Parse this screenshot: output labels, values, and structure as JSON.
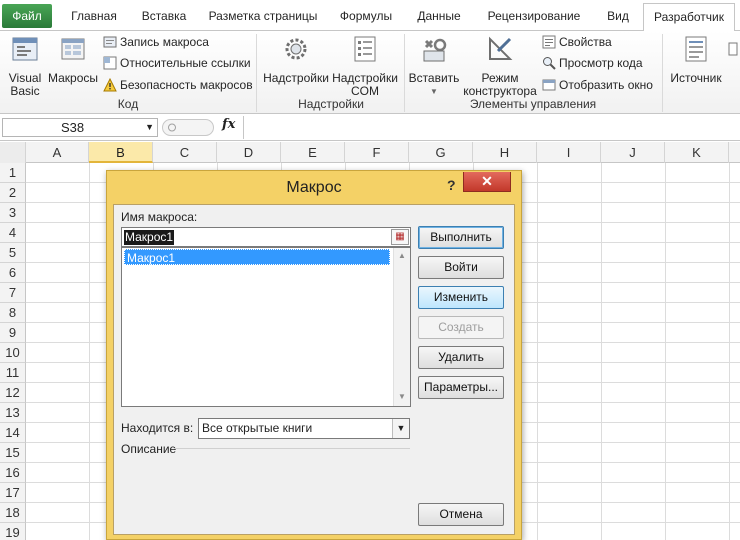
{
  "tabs": [
    "Файл",
    "Главная",
    "Вставка",
    "Разметка страницы",
    "Формулы",
    "Данные",
    "Рецензирование",
    "Вид",
    "Разработчик"
  ],
  "ribbon": {
    "code_group": {
      "label": "Код",
      "visual_basic": [
        "Visual",
        "Basic"
      ],
      "macros": "Макросы",
      "record_macro": "Запись макроса",
      "relative_refs": "Относительные ссылки",
      "macro_security": "Безопасность макросов"
    },
    "addins_group": {
      "label": "Надстройки",
      "addins": "Надстройки",
      "com_addins": [
        "Надстройки",
        "COM"
      ]
    },
    "controls_group": {
      "label": "Элементы управления",
      "insert": "Вставить",
      "design_mode": [
        "Режим",
        "конструктора"
      ],
      "properties": "Свойства",
      "view_code": "Просмотр кода",
      "run_dialog": "Отобразить окно"
    },
    "xml_group": {
      "source": "Источник"
    }
  },
  "formula_bar": {
    "name_box": "S38",
    "fx": "fx"
  },
  "grid": {
    "columns": [
      "A",
      "B",
      "C",
      "D",
      "E",
      "F",
      "G",
      "H",
      "I",
      "J",
      "K"
    ],
    "rows": [
      "1",
      "2",
      "3",
      "4",
      "5",
      "6",
      "7",
      "8",
      "9",
      "10",
      "11",
      "12",
      "13",
      "14",
      "15",
      "16",
      "17",
      "18",
      "19"
    ]
  },
  "dialog": {
    "title": "Макрос",
    "help": "?",
    "close": "✕",
    "macro_name_label": "Имя макроса:",
    "macro_name_value": "Макрос1",
    "macro_list": [
      "Макрос1"
    ],
    "location_label": "Находится в:",
    "location_value": "Все открытые книги",
    "description_label": "Описание",
    "buttons": {
      "run": "Выполнить",
      "step_into": "Войти",
      "edit": "Изменить",
      "create": "Создать",
      "delete": "Удалить",
      "options": "Параметры...",
      "cancel": "Отмена"
    }
  },
  "colors": {
    "file_tab": "#3a8f46",
    "dialog_frame": "#f4d166",
    "selection": "#3399ff",
    "close_button": "#c7392b"
  }
}
